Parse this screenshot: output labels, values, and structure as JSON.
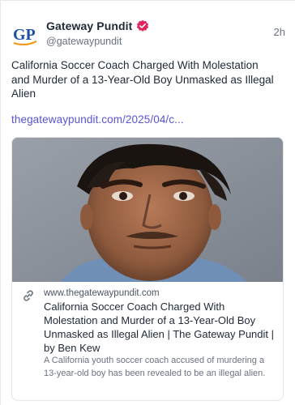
{
  "post": {
    "author_name": "Gateway Pundit",
    "author_handle": "@gatewaypundit",
    "time": "2h",
    "text": "California Soccer Coach Charged With Molestation and Murder of a 13-Year-Old Boy Unmasked as Illegal Alien",
    "link": "thegatewaypundit.com/2025/04/c..."
  },
  "avatar": {
    "logo_text": "GP"
  },
  "card": {
    "domain": "www.thegatewaypundit.com",
    "title": "California Soccer Coach Charged With Molestation and Murder of a 13-Year-Old Boy Unmasked as Illegal Alien | The Gateway Pundit | by Ben Kew",
    "description": "A California youth soccer coach accused of murdering a 13-year-old boy has been revealed to be an illegal alien."
  },
  "colors": {
    "link": "#5b53d6",
    "verified": "#e0245e",
    "logo_blue": "#1e4fa3",
    "logo_orange": "#f29a1d"
  },
  "icons": {
    "verified": "verified-badge-icon",
    "link": "chain-link-icon"
  }
}
